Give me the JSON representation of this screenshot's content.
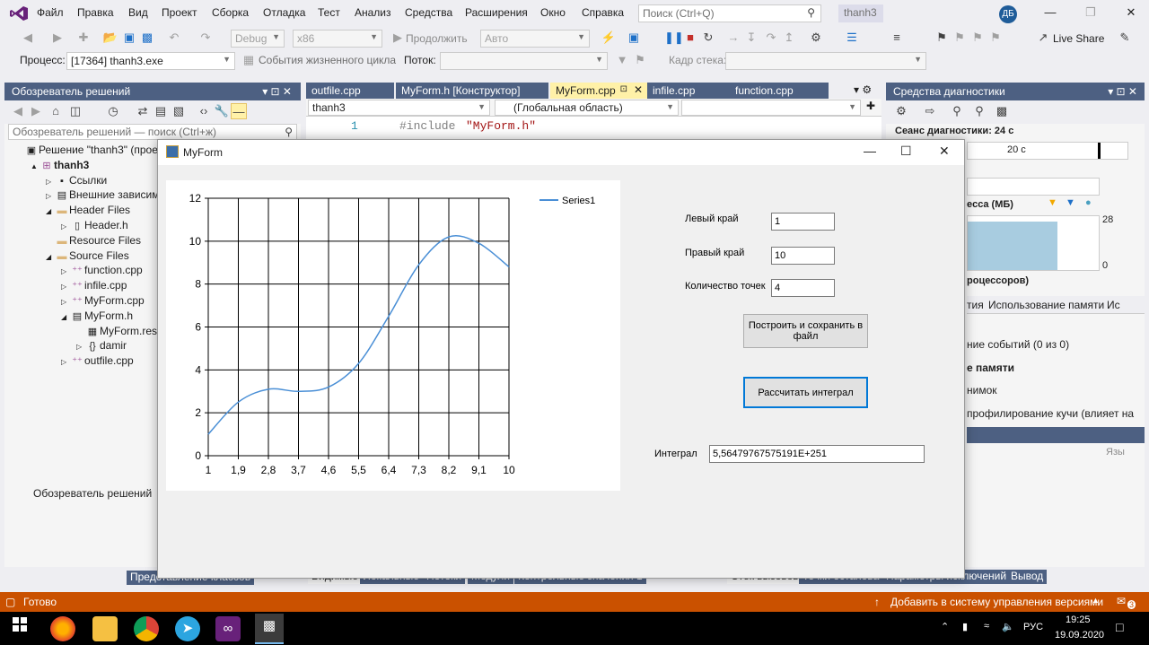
{
  "menu": {
    "items": [
      "Файл",
      "Правка",
      "Вид",
      "Проект",
      "Сборка",
      "Отладка",
      "Тест",
      "Анализ",
      "Средства",
      "Расширения",
      "Окно",
      "Справка"
    ],
    "search_placeholder": "Поиск (Ctrl+Q)",
    "solution_badge": "thanh3",
    "user_initials": "ДБ"
  },
  "toolbar": {
    "config": "Debug",
    "platform": "x86",
    "continue_label": "Продолжить",
    "auto_label": "Авто",
    "live_share": "Live Share",
    "process_label": "Процесс:",
    "process_value": "[17364] thanh3.exe",
    "lifecycle_label": "События жизненного цикла",
    "thread_label": "Поток:",
    "stack_label": "Кадр стека:"
  },
  "solution_explorer": {
    "title": "Обозреватель решений",
    "search_placeholder": "Обозреватель решений — поиск (Ctrl+ж)",
    "tree": [
      {
        "label": "Решение \"thanh3\" (проект",
        "indent": 0,
        "icon": "solution-icon",
        "expander": ""
      },
      {
        "label": "thanh3",
        "indent": 1,
        "icon": "project-icon",
        "expander": "▲",
        "bold": true
      },
      {
        "label": "Ссылки",
        "indent": 2,
        "icon": "references-icon",
        "expander": "▷"
      },
      {
        "label": "Внешние зависимос",
        "indent": 2,
        "icon": "external-deps-icon",
        "expander": "▷"
      },
      {
        "label": "Header Files",
        "indent": 2,
        "icon": "folder-icon",
        "expander": "◢"
      },
      {
        "label": "Header.h",
        "indent": 3,
        "icon": "header-file-icon",
        "expander": "▷"
      },
      {
        "label": "Resource Files",
        "indent": 2,
        "icon": "folder-icon",
        "expander": ""
      },
      {
        "label": "Source Files",
        "indent": 2,
        "icon": "folder-icon",
        "expander": "◢"
      },
      {
        "label": "function.cpp",
        "indent": 3,
        "icon": "cpp-file-icon",
        "expander": "▷"
      },
      {
        "label": "infile.cpp",
        "indent": 3,
        "icon": "cpp-file-icon",
        "expander": "▷"
      },
      {
        "label": "MyForm.cpp",
        "indent": 3,
        "icon": "cpp-file-icon",
        "expander": "▷"
      },
      {
        "label": "MyForm.h",
        "indent": 3,
        "icon": "form-file-icon",
        "expander": "◢"
      },
      {
        "label": "MyForm.resx",
        "indent": 4,
        "icon": "resx-file-icon",
        "expander": ""
      },
      {
        "label": "damir",
        "indent": 4,
        "icon": "namespace-icon",
        "expander": "▷"
      },
      {
        "label": "outfile.cpp",
        "indent": 3,
        "icon": "cpp-file-icon",
        "expander": "▷"
      }
    ],
    "bottom_tabs": [
      "Обозреватель решений",
      "Представление классов"
    ]
  },
  "editor": {
    "tabs": [
      "outfile.cpp",
      "MyForm.h [Конструктор]",
      "MyForm.cpp",
      "infile.cpp",
      "function.cpp"
    ],
    "active_tab": "MyForm.cpp",
    "scope_project": "thanh3",
    "scope_global": "(Глобальная область)",
    "line_number": "1",
    "code_directive": "#include",
    "code_string": "\"MyForm.h\"",
    "bottom_tabs": [
      "Видимые",
      "Локальные",
      "Потоки",
      "Модули",
      "Контрольные значения 1"
    ]
  },
  "diagnostics": {
    "title": "Средства диагностики",
    "session": "Сеанс диагностики: 24 с",
    "timeline_label": "20 с",
    "memory_label": "ecca (МБ)",
    "mem_max": "28",
    "mem_min": "0",
    "cpu_label": "роцессоров)",
    "tabs": [
      "тия",
      "Использование памяти",
      "Ис"
    ],
    "events": "ние событий (0 из 0)",
    "memory_section": "е памяти",
    "snapshot": "нимок",
    "heap_profiling": "профилирование кучи (влияет на",
    "lang_header": "Язы",
    "bottom_tabs": [
      "Стек вызовов",
      "Точки останова",
      "Параметры исключений",
      "Вывод"
    ]
  },
  "status": {
    "ready": "Готово",
    "source_control": "Добавить в систему управления версиями",
    "notifications": "3"
  },
  "taskbar": {
    "language": "РУС",
    "time": "19:25",
    "date": "19.09.2020",
    "apps": [
      "windows-start-icon",
      "firefox-icon",
      "file-explorer-icon",
      "chrome-icon",
      "telegram-icon",
      "visual-studio-icon",
      "myform-app-icon"
    ]
  },
  "myform": {
    "title": "MyForm",
    "left_label": "Левый край",
    "left_value": "1",
    "right_label": "Правый край",
    "right_value": "10",
    "points_label": "Количество точек",
    "points_value": "4",
    "build_button": "Построить и  сохранить в файл",
    "calc_button": "Рассчитать интеграл",
    "integral_label": "Интеграл",
    "integral_value": "5,56479767575191E+251"
  },
  "chart_data": {
    "type": "line",
    "x_tick_labels": [
      "1",
      "1,9",
      "2,8",
      "3,7",
      "4,6",
      "5,5",
      "6,4",
      "7,3",
      "8,2",
      "9,1",
      "10"
    ],
    "xlim": [
      1,
      10
    ],
    "ylim": [
      0,
      12
    ],
    "y_ticks": [
      0,
      2,
      4,
      6,
      8,
      10,
      12
    ],
    "grid": true,
    "legend_position": "top-right",
    "series": [
      {
        "name": "Series1",
        "color": "#4a8fd6",
        "x": [
          1,
          1.9,
          2.8,
          3.7,
          4.6,
          5.5,
          6.4,
          7.3,
          8.2,
          9.1,
          10
        ],
        "y": [
          1.0,
          2.5,
          3.1,
          3.0,
          3.2,
          4.3,
          6.5,
          8.9,
          10.2,
          9.9,
          8.8
        ]
      }
    ]
  }
}
